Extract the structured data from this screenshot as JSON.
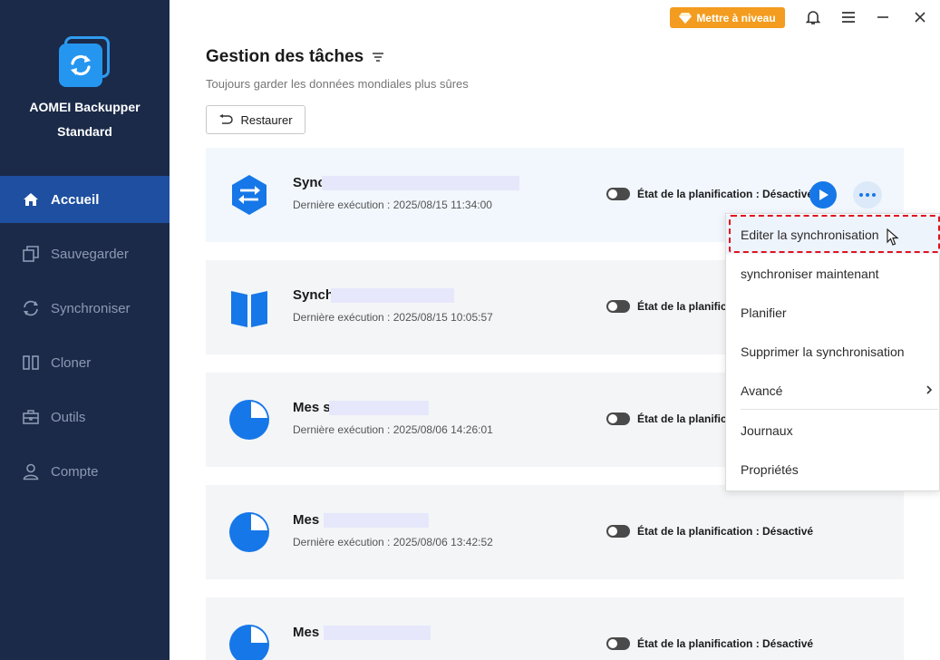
{
  "app": {
    "name_line1": "AOMEI Backupper",
    "name_line2": "Standard",
    "upgrade_label": "Mettre à niveau"
  },
  "sidebar": {
    "items": [
      {
        "label": "Accueil",
        "icon": "home-icon",
        "active": true
      },
      {
        "label": "Sauvegarder",
        "icon": "backup-icon"
      },
      {
        "label": "Synchroniser",
        "icon": "sync-icon"
      },
      {
        "label": "Cloner",
        "icon": "clone-icon"
      },
      {
        "label": "Outils",
        "icon": "toolbox-icon"
      },
      {
        "label": "Compte",
        "icon": "user-icon"
      }
    ]
  },
  "header": {
    "title": "Gestion des tâches",
    "subtitle": "Toujours garder les données mondiales plus sûres",
    "restore_label": "Restaurer"
  },
  "tasks": [
    {
      "name": "Sync",
      "last_run": "Dernière exécution : 2025/08/15 11:34:00",
      "schedule": "État de la planification : Désactivé",
      "icon": "sync-hexagon-icon"
    },
    {
      "name": "Synch",
      "last_run": "Dernière exécution : 2025/08/15 10:05:57",
      "schedule": "État de la planification",
      "icon": "mirror-sync-icon"
    },
    {
      "name": "Mes s",
      "last_run": "Dernière exécution : 2025/08/06 14:26:01",
      "schedule": "État de la planification",
      "icon": "pie-chart-icon"
    },
    {
      "name": "Mes",
      "last_run": "Dernière exécution : 2025/08/06 13:42:52",
      "schedule": "État de la planification : Désactivé",
      "icon": "pie-chart-icon"
    },
    {
      "name": "Mes",
      "last_run": "",
      "schedule": "État de la planification : Désactivé",
      "icon": "pie-chart-icon"
    }
  ],
  "menu": {
    "items": [
      "Editer la synchronisation",
      "synchroniser maintenant",
      "Planifier",
      "Supprimer la synchronisation",
      "Avancé",
      "Journaux",
      "Propriétés"
    ]
  },
  "colors": {
    "sidebar_bg": "#1b2a49",
    "sidebar_active": "#1e4fa0",
    "accent": "#1677e8",
    "upgrade": "#f39c1f",
    "focus_outline": "#e1121d"
  }
}
